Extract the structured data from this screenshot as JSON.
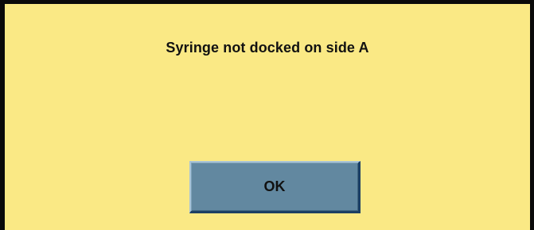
{
  "dialog": {
    "message": "Syringe not docked on side A",
    "ok_label": "OK"
  },
  "colors": {
    "background": "#fae985",
    "border": "#0a0a0a",
    "button": "#6288a0",
    "button_border_dark": "#1c3f63",
    "text": "#111111"
  }
}
